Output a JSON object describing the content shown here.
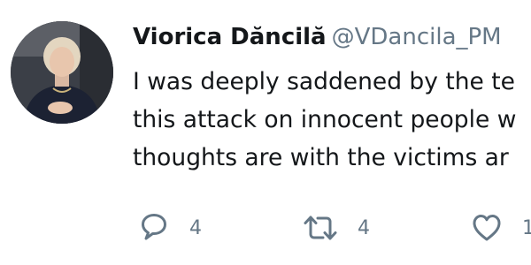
{
  "tweet": {
    "author": {
      "display_name": "Viorica Dăncilă",
      "handle": "@VDancila_PM",
      "avatar_icon": "profile-photo"
    },
    "text_lines": [
      "I was deeply saddened by the te",
      "this attack on innocent people w",
      "thoughts are with the victims ar"
    ],
    "actions": {
      "reply": {
        "icon": "reply-icon",
        "count": "4"
      },
      "retweet": {
        "icon": "retweet-icon",
        "count": "4"
      },
      "like": {
        "icon": "heart-icon",
        "count": "1"
      }
    }
  },
  "colors": {
    "text": "#14171a",
    "secondary": "#657786",
    "icon": "#657786"
  }
}
